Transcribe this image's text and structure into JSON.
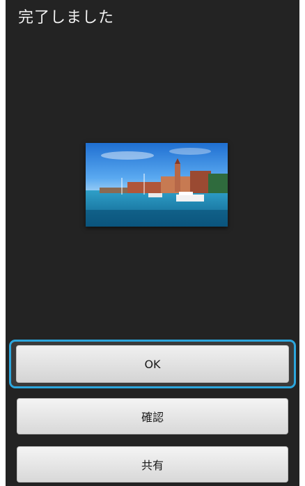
{
  "dialog": {
    "title": "完了しました"
  },
  "preview": {
    "image": "harbor-photo"
  },
  "buttons": {
    "ok_label": "OK",
    "confirm_label": "確認",
    "share_label": "共有"
  },
  "colors": {
    "panel": "#232323",
    "focus": "#2ca6dd"
  }
}
